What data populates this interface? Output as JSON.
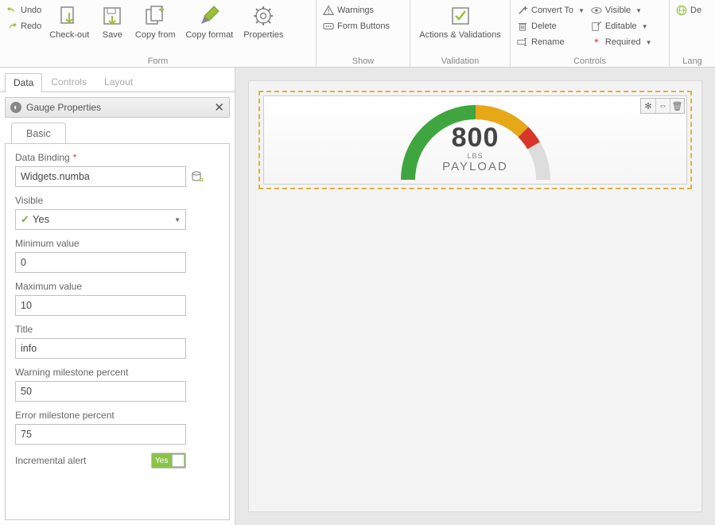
{
  "ribbon": {
    "undo": "Undo",
    "redo": "Redo",
    "checkout": "Check-out",
    "save": "Save",
    "copyfrom": "Copy from",
    "copyformat": "Copy format",
    "properties": "Properties",
    "group_form": "Form",
    "warnings": "Warnings",
    "form_buttons": "Form Buttons",
    "group_show": "Show",
    "actions": "Actions & Validations",
    "group_validation": "Validation",
    "convert": "Convert To",
    "delete": "Delete",
    "rename": "Rename",
    "visible": "Visible",
    "editable": "Editable",
    "required": "Required",
    "group_controls": "Controls",
    "de": "De",
    "group_lang": "Lang"
  },
  "tabs": {
    "data": "Data",
    "controls": "Controls",
    "layout": "Layout"
  },
  "panel_title": "Gauge Properties",
  "subtab_basic": "Basic",
  "fields": {
    "data_binding_label": "Data Binding",
    "data_binding_value": "Widgets.numba",
    "visible_label": "Visible",
    "visible_value": "Yes",
    "min_label": "Minimum value",
    "min_value": "0",
    "max_label": "Maximum value",
    "max_value": "10",
    "title_label": "Title",
    "title_value": "info",
    "warn_label": "Warning milestone percent",
    "warn_value": "50",
    "err_label": "Error milestone percent",
    "err_value": "75",
    "inc_label": "Incremental alert",
    "inc_value": "Yes"
  },
  "gauge": {
    "value": "800",
    "unit": "LBS",
    "title": "PAYLOAD"
  }
}
